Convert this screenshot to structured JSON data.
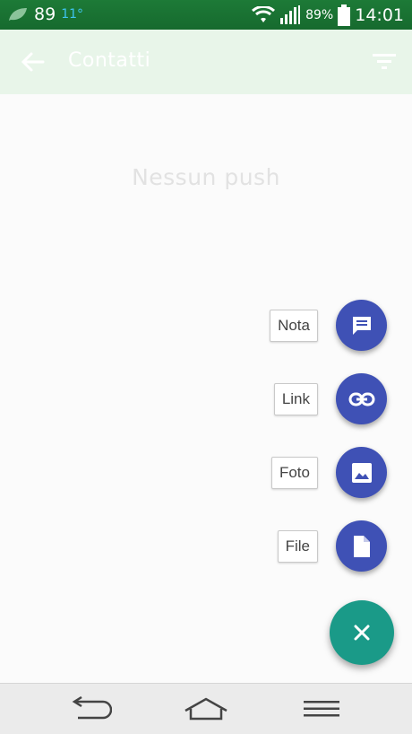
{
  "status_bar": {
    "notification_count": "89",
    "temperature": "11°",
    "battery_percent": "89%",
    "time": "14:01",
    "icons": [
      "leaf-icon",
      "wifi-icon",
      "signal-icon",
      "battery-icon"
    ]
  },
  "app_bar": {
    "title": "Contatti",
    "back_icon": "arrow-back-icon",
    "filter_icon": "filter-icon",
    "background": "#e8f5e9"
  },
  "empty_state": {
    "text": "Nessun push"
  },
  "fab_menu": {
    "items": [
      {
        "label": "Nota",
        "icon": "message-icon"
      },
      {
        "label": "Link",
        "icon": "link-icon"
      },
      {
        "label": "Foto",
        "icon": "image-icon"
      },
      {
        "label": "File",
        "icon": "file-icon"
      }
    ],
    "main_icon": "close-icon",
    "mini_color": "#3f51b5",
    "main_color": "#1a9a88"
  },
  "nav_bar": {
    "buttons": [
      "back-nav-icon",
      "home-nav-icon",
      "menu-nav-icon"
    ]
  }
}
